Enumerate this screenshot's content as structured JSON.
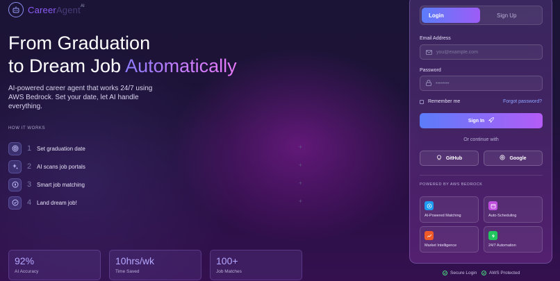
{
  "brand": {
    "name_prefix": "Career",
    "name_suffix": "Agent",
    "superscript": "AI"
  },
  "hero": {
    "line1": "From Graduation",
    "line2_plain": "to Dream Job ",
    "line2_accent": "Automatically",
    "description": "AI-powered career agent that works 24/7 using AWS Bedrock. Set your date, let AI handle everything."
  },
  "how_it_works": {
    "heading": "HOW IT WORKS",
    "steps": [
      {
        "num": "1",
        "label": "Set graduation date",
        "icon": "target-icon"
      },
      {
        "num": "2",
        "label": "AI scans job portals",
        "icon": "sparkles-icon"
      },
      {
        "num": "3",
        "label": "Smart job matching",
        "icon": "compass-icon"
      },
      {
        "num": "4",
        "label": "Land dream job!",
        "icon": "check-circle-icon"
      }
    ],
    "plus": "+"
  },
  "stats": [
    {
      "value": "92%",
      "label": "AI Accuracy"
    },
    {
      "value": "10hrs/wk",
      "label": "Time Saved"
    },
    {
      "value": "100+",
      "label": "Job Matches"
    }
  ],
  "auth": {
    "tabs": {
      "login": "Login",
      "signup": "Sign Up"
    },
    "email": {
      "label": "Email Address",
      "placeholder": "you@example.com",
      "value": ""
    },
    "password": {
      "label": "Password",
      "placeholder": "••••••••",
      "value": ""
    },
    "remember": "Remember me",
    "forgot": "Forgot password?",
    "signin": "Sign In",
    "or": "Or continue with",
    "github": "GitHub",
    "google": "Google"
  },
  "powered": {
    "heading": "POWERED BY AWS BEDROCK",
    "features": [
      {
        "label": "AI-Powered Matching",
        "icon": "target-icon",
        "color": "#1e9bf0"
      },
      {
        "label": "Auto-Scheduling",
        "icon": "calendar-icon",
        "color": "#c04fe0"
      },
      {
        "label": "Market Intelligence",
        "icon": "trending-up-icon",
        "color": "#f05a28"
      },
      {
        "label": "24/7 Automation",
        "icon": "bolt-icon",
        "color": "#22c55e"
      }
    ]
  },
  "security": {
    "secure_login": "Secure Login",
    "aws_protected": "AWS Protected"
  },
  "colors": {
    "accent": "#8b5cf6",
    "button_start": "#5b7cfa",
    "button_end": "#b45cf6",
    "success": "#4ade80"
  }
}
